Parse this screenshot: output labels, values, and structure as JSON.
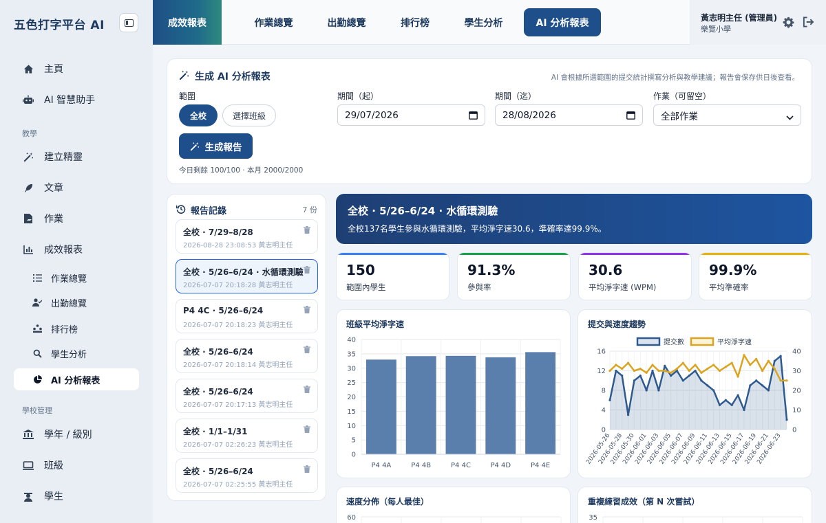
{
  "app": {
    "brand": "五色打字平台 AI"
  },
  "sidebar": {
    "items": [
      {
        "label": "主頁",
        "icon": "home-icon"
      },
      {
        "label": "AI 智慧助手",
        "icon": "robot-icon"
      }
    ],
    "section_teaching": "教學",
    "teaching_items": [
      {
        "label": "建立精靈",
        "icon": "magic-wand-icon"
      },
      {
        "label": "文章",
        "icon": "feather-icon"
      },
      {
        "label": "作業",
        "icon": "assignment-icon"
      },
      {
        "label": "成效報表",
        "icon": "bar-chart-icon"
      }
    ],
    "report_sub_items": [
      {
        "label": "作業總覽",
        "icon": "list-icon"
      },
      {
        "label": "出勤總覽",
        "icon": "user-check-icon"
      },
      {
        "label": "排行榜",
        "icon": "ranking-icon"
      },
      {
        "label": "學生分析",
        "icon": "search-icon"
      },
      {
        "label": "AI 分析報表",
        "icon": "pie-chart-icon",
        "active": true
      }
    ],
    "section_school": "學校管理",
    "school_items": [
      {
        "label": "學年 / 級別",
        "icon": "building-icon"
      },
      {
        "label": "班級",
        "icon": "monitor-icon"
      },
      {
        "label": "學生",
        "icon": "student-icon"
      }
    ]
  },
  "topbar": {
    "section_label": "成效報表",
    "tabs": [
      {
        "label": "作業總覽"
      },
      {
        "label": "出勤總覽"
      },
      {
        "label": "排行榜"
      },
      {
        "label": "學生分析"
      },
      {
        "label": "AI 分析報表",
        "active": true
      }
    ],
    "user": {
      "name": "黃志明主任 (管理員)",
      "school": "樂覽小學"
    }
  },
  "generator": {
    "title": "生成 AI 分析報表",
    "hint": "AI 會根據所選範圍的提交統計撰寫分析與教學建議；報告會保存供日後查看。",
    "scope_label": "範圍",
    "scope_all": "全校",
    "scope_class": "選擇班級",
    "from_label": "期間（起）",
    "from_value": "29/07/2026",
    "to_label": "期間（迄）",
    "to_value": "28/08/2026",
    "assignment_label": "作業（可留空）",
    "assignment_value": "全部作業",
    "button": "生成報告",
    "quota": "今日剩餘 100/100 · 本月 2000/2000"
  },
  "history": {
    "title": "報告記錄",
    "count": "7 份",
    "items": [
      {
        "title": "全校 · 7/29–8/28",
        "meta": "2026-08-28 23:08:53  黃志明主任"
      },
      {
        "title": "全校 · 5/26–6/24 · 水循環測驗",
        "meta": "2026-07-07 20:18:28  黃志明主任",
        "selected": true
      },
      {
        "title": "P4 4C · 5/26–6/24",
        "meta": "2026-07-07 20:18:23  黃志明主任"
      },
      {
        "title": "全校 · 5/26–6/24",
        "meta": "2026-07-07 20:18:14  黃志明主任"
      },
      {
        "title": "全校 · 5/26–6/24",
        "meta": "2026-07-07 20:17:13  黃志明主任"
      },
      {
        "title": "全校 · 1/1–1/31",
        "meta": "2026-07-07 02:26:23  黃志明主任"
      },
      {
        "title": "全校 · 5/26–6/24",
        "meta": "2026-07-07 02:25:55  黃志明主任"
      }
    ]
  },
  "report": {
    "title": "全校 · 5/26–6/24 · 水循環測驗",
    "summary": "全校137名學生參與水循環測驗，平均淨字速30.6，準確率達99.9%。",
    "stats": [
      {
        "value": "150",
        "label": "範圍內學生",
        "color": "#3b82f6"
      },
      {
        "value": "91.3%",
        "label": "參與率",
        "color": "#16a34a"
      },
      {
        "value": "30.6",
        "label": "平均淨字速 (WPM)",
        "color": "#9333ea"
      },
      {
        "value": "99.9%",
        "label": "平均準確率",
        "color": "#eab308"
      }
    ]
  },
  "chart_data": [
    {
      "type": "bar",
      "title": "班級平均淨字速",
      "categories": [
        "P4 4A",
        "P4 4B",
        "P4 4C",
        "P4 4D",
        "P4 4E"
      ],
      "values": [
        33.0,
        34.2,
        34.3,
        33.8,
        35.6
      ],
      "ylim": [
        0,
        40
      ],
      "yticks": [
        0,
        5,
        10,
        15,
        20,
        25,
        30,
        35,
        40
      ],
      "color": "#5b7fad",
      "grid": true
    },
    {
      "type": "line",
      "title": "提交與速度趨勢",
      "legend_placement": "top",
      "x": [
        "2026-05-26",
        "2026-05-27",
        "2026-05-28",
        "2026-05-29",
        "2026-05-30",
        "2026-05-31",
        "2026-06-01",
        "2026-06-02",
        "2026-06-03",
        "2026-06-04",
        "2026-06-05",
        "2026-06-06",
        "2026-06-07",
        "2026-06-08",
        "2026-06-09",
        "2026-06-10",
        "2026-06-11",
        "2026-06-12",
        "2026-06-13",
        "2026-06-14",
        "2026-06-15",
        "2026-06-16",
        "2026-06-17",
        "2026-06-18",
        "2026-06-19",
        "2026-06-20",
        "2026-06-21",
        "2026-06-22",
        "2026-06-23",
        "2026-06-24"
      ],
      "xticks": [
        "2026-05-26",
        "2026-05-28",
        "2026-05-30",
        "2026-06-01",
        "2026-06-03",
        "2026-06-05",
        "2026-06-07",
        "2026-06-09",
        "2026-06-11",
        "2026-06-13",
        "2026-06-15",
        "2026-06-17",
        "2026-06-19",
        "2026-06-21",
        "2026-06-23"
      ],
      "series": [
        {
          "name": "提交數",
          "axis": "left",
          "color": "#2f5a8f",
          "fill": true,
          "values": [
            6,
            12,
            11,
            3,
            10,
            11,
            8,
            12,
            8,
            13,
            11,
            12,
            10,
            11,
            12,
            10,
            9,
            8,
            5,
            6,
            5,
            7,
            4,
            9,
            10,
            9,
            8,
            14,
            15,
            2
          ]
        },
        {
          "name": "平均淨字速",
          "axis": "right",
          "color": "#d9a520",
          "values": [
            30,
            33,
            31,
            34,
            30,
            31,
            29,
            33,
            30,
            30,
            29,
            31,
            34,
            30,
            33,
            29,
            31,
            33,
            30,
            32,
            34,
            27,
            38,
            33,
            36,
            30,
            35,
            31,
            25,
            25
          ]
        }
      ],
      "ylim_left": [
        0,
        16
      ],
      "yticks_left": [
        0,
        4,
        8,
        12,
        16
      ],
      "ylim_right": [
        0,
        40
      ],
      "yticks_right": [
        0,
        10,
        20,
        30,
        40
      ]
    },
    {
      "type": "bar",
      "title": "速度分佈（每人最佳）",
      "yticks_visible": [
        60
      ]
    },
    {
      "type": "bar",
      "title": "重複練習成效（第 N 次嘗試）",
      "yticks_visible": [
        35
      ]
    }
  ]
}
